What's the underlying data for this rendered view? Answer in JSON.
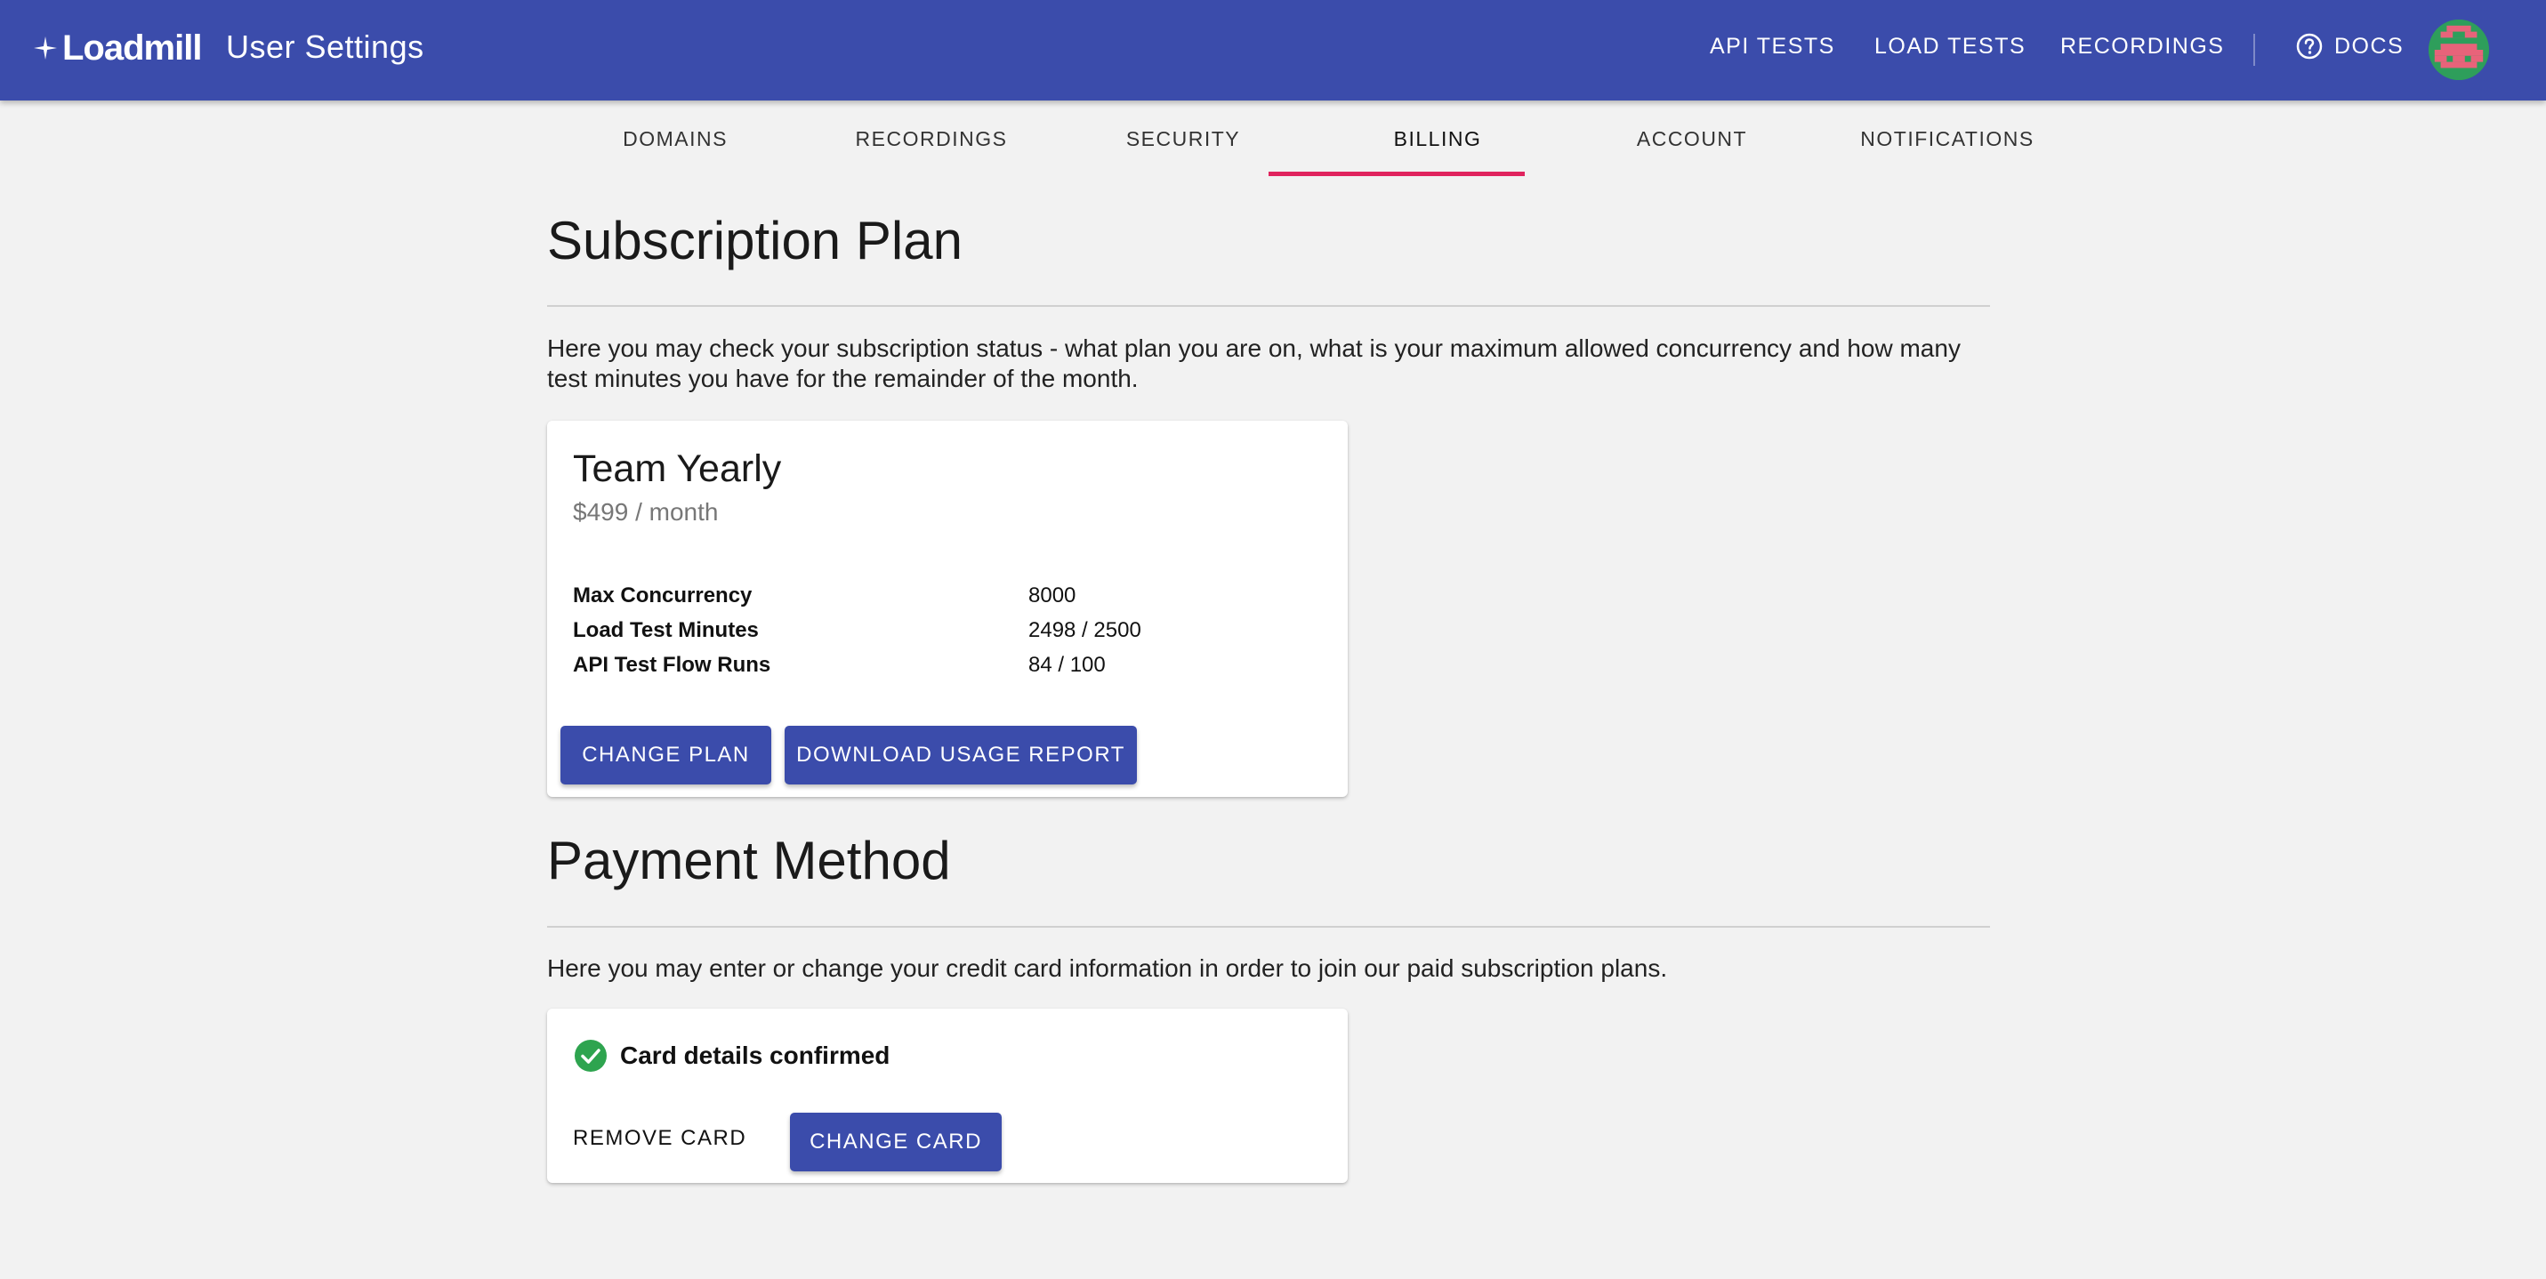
{
  "header": {
    "logo_text": "Loadmill",
    "title": "User Settings",
    "nav": {
      "api_tests": "API TESTS",
      "load_tests": "LOAD TESTS",
      "recordings": "RECORDINGS",
      "docs": "DOCS"
    },
    "brand_color": "#3b4cab"
  },
  "tabs": {
    "items": [
      "DOMAINS",
      "RECORDINGS",
      "SECURITY",
      "BILLING",
      "ACCOUNT",
      "NOTIFICATIONS"
    ],
    "active": "BILLING",
    "indicator_color": "#e0245e"
  },
  "subscription": {
    "heading": "Subscription Plan",
    "description": "Here you may check your subscription status - what plan you are on, what is your maximum allowed concurrency and how many test minutes you have for the remainder of the month.",
    "plan_name": "Team Yearly",
    "price": "$499 / month",
    "details": [
      {
        "key": "Max Concurrency",
        "value": "8000"
      },
      {
        "key": "Load Test Minutes",
        "value": "2498 / 2500"
      },
      {
        "key": "API Test Flow Runs",
        "value": "84 / 100"
      }
    ],
    "change_plan_label": "CHANGE PLAN",
    "download_report_label": "DOWNLOAD USAGE REPORT"
  },
  "payment": {
    "heading": "Payment Method",
    "description": "Here you may enter or change your credit card information in order to join our paid subscription plans.",
    "status": "Card details confirmed",
    "status_color": "#2ea44f",
    "remove_card_label": "REMOVE CARD",
    "change_card_label": "CHANGE CARD"
  }
}
